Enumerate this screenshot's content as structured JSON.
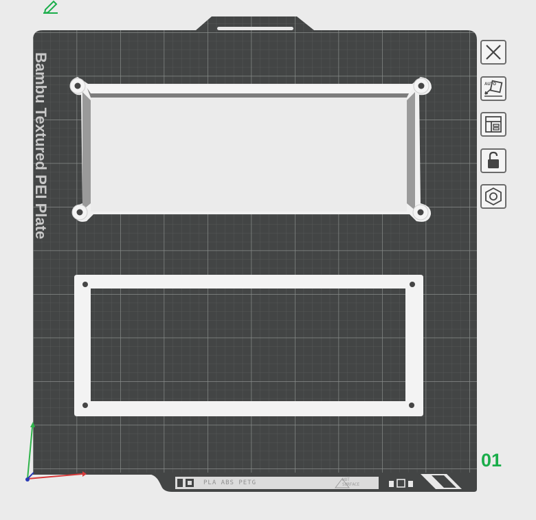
{
  "plate": {
    "name": "Bambu Textured PEI Plate",
    "number": "01",
    "filament_label": "PLA ABS PETG",
    "hot_surface_label": "HOT\nSURFACE"
  },
  "colors": {
    "background": "#ebebeb",
    "plate": "#434545",
    "grid": "#5f6261",
    "object": "#f2f2f2",
    "accent": "#1aad4a",
    "axis_x": "#d63a3a",
    "axis_y": "#2fb34a",
    "axis_z": "#2a3bb5"
  },
  "toolbar": {
    "items": [
      {
        "icon": "close-icon",
        "label": "Remove plate"
      },
      {
        "icon": "auto-orient-icon",
        "label": "Auto orient"
      },
      {
        "icon": "arrange-icon",
        "label": "Arrange"
      },
      {
        "icon": "lock-icon",
        "label": "Lock plate"
      },
      {
        "icon": "plate-settings-icon",
        "label": "Plate settings"
      }
    ]
  },
  "top_left": {
    "icon": "edit-icon"
  }
}
